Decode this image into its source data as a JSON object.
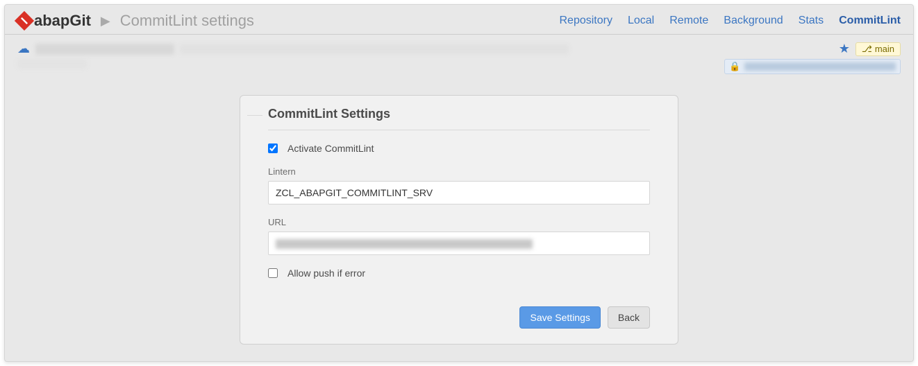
{
  "header": {
    "logo_text": "abapGit",
    "breadcrumb": "CommitLint settings"
  },
  "nav": {
    "items": [
      {
        "label": "Repository",
        "active": false
      },
      {
        "label": "Local",
        "active": false
      },
      {
        "label": "Remote",
        "active": false
      },
      {
        "label": "Background",
        "active": false
      },
      {
        "label": "Stats",
        "active": false
      },
      {
        "label": "CommitLint",
        "active": true
      }
    ]
  },
  "repo_bar": {
    "branch_label": "main"
  },
  "panel": {
    "title": "CommitLint Settings",
    "activate_label": "Activate CommitLint",
    "activate_checked": true,
    "lintern_label": "Lintern",
    "lintern_value": "ZCL_ABAPGIT_COMMITLINT_SRV",
    "url_label": "URL",
    "allow_push_label": "Allow push if error",
    "allow_push_checked": false,
    "save_button": "Save Settings",
    "back_button": "Back"
  }
}
